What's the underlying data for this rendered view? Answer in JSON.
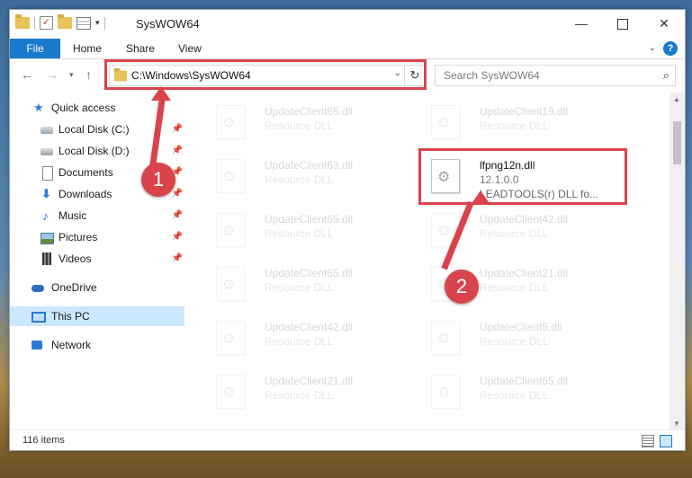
{
  "window": {
    "title": "SysWOW64"
  },
  "ribbon": {
    "file": "File",
    "tabs": [
      "Home",
      "Share",
      "View"
    ],
    "help": "?"
  },
  "address": {
    "path": "C:\\Windows\\SysWOW64",
    "refresh": "↻",
    "dropdown": "⌄"
  },
  "search": {
    "placeholder": "Search SysWOW64"
  },
  "sidebar": {
    "items": [
      {
        "label": "Quick access",
        "icon": "star-icon",
        "pinned": false
      },
      {
        "label": "Local Disk (C:)",
        "icon": "drive-icon",
        "pinned": true
      },
      {
        "label": "Local Disk (D:)",
        "icon": "drive-icon",
        "pinned": true
      },
      {
        "label": "Documents",
        "icon": "documents-icon",
        "pinned": true
      },
      {
        "label": "Downloads",
        "icon": "download-icon",
        "pinned": true
      },
      {
        "label": "Music",
        "icon": "music-icon",
        "pinned": true
      },
      {
        "label": "Pictures",
        "icon": "pictures-icon",
        "pinned": true
      },
      {
        "label": "Videos",
        "icon": "videos-icon",
        "pinned": true
      },
      {
        "label": "OneDrive",
        "icon": "cloud-icon",
        "pinned": false
      },
      {
        "label": "This PC",
        "icon": "computer-icon",
        "pinned": false,
        "selected": true
      },
      {
        "label": "Network",
        "icon": "network-icon",
        "pinned": false
      }
    ]
  },
  "files": {
    "left": [
      {
        "name": "UpdateClient65.dll",
        "type": "Resource DLL"
      },
      {
        "name": "UpdateClient63.dll",
        "type": "Resource DLL"
      },
      {
        "name": "UpdateClient65.dll",
        "type": "Resource DLL"
      },
      {
        "name": "UpdateClient65.dll",
        "type": "Resource DLL"
      },
      {
        "name": "UpdateClient42.dll",
        "type": "Resource DLL"
      },
      {
        "name": "UpdateClient21.dll",
        "type": "Resource DLL"
      }
    ],
    "right": [
      {
        "name": "UpdateClient19.dll",
        "type": "Resource DLL"
      },
      {
        "name": "lfpng12n.dll",
        "type": "12.1.0.0",
        "desc": "LEADTOOLS(r) DLL fo...",
        "highlight": true
      },
      {
        "name": "UpdateClient42.dll",
        "type": "Resource DLL"
      },
      {
        "name": "UpdateClient21.dll",
        "type": "Resource DLL"
      },
      {
        "name": "UpdateClient5.dll",
        "type": "Resource DLL"
      },
      {
        "name": "UpdateClient65.dll",
        "type": "Resource DLL"
      }
    ]
  },
  "status": {
    "count": "116 items"
  },
  "annotations": {
    "step1": "1",
    "step2": "2",
    "color": "#d9444a"
  }
}
